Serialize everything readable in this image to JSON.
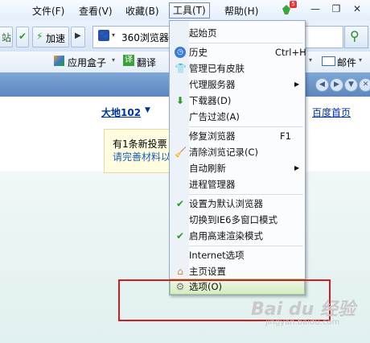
{
  "menubar": {
    "items": [
      "文件(F)",
      "查看(V)",
      "收藏(B)",
      "工具(T)",
      "帮助(H)"
    ],
    "badge": "5"
  },
  "toolbar": {
    "left_text": "站",
    "speed_label": "加速",
    "address_text": "360浏览器"
  },
  "favbar": {
    "items": [
      "应用盒子",
      "翻译",
      "邮件"
    ]
  },
  "content": {
    "user_link": "大地102",
    "homepage_link": "百度首页",
    "popup_line1": "有1条新投票",
    "popup_line2": "请完善材料以"
  },
  "tools_menu": {
    "items": [
      {
        "label": "起始页",
        "shortcut": "",
        "icon": "",
        "submenu": false
      },
      {
        "label": "历史",
        "shortcut": "Ctrl+H",
        "icon": "clock-icon",
        "submenu": false
      },
      {
        "label": "管理已有皮肤",
        "shortcut": "",
        "icon": "shirt-icon",
        "submenu": false
      },
      {
        "label": "代理服务器",
        "shortcut": "",
        "icon": "",
        "submenu": true
      },
      {
        "label": "下载器(D)",
        "shortcut": "",
        "icon": "download-icon",
        "submenu": false
      },
      {
        "label": "广告过滤(A)",
        "shortcut": "",
        "icon": "",
        "submenu": false
      },
      {
        "label": "修复浏览器",
        "shortcut": "F1",
        "icon": "",
        "submenu": false
      },
      {
        "label": "清除浏览记录(C)",
        "shortcut": "",
        "icon": "broom-icon",
        "submenu": false
      },
      {
        "label": "自动刷新",
        "shortcut": "",
        "icon": "",
        "submenu": true
      },
      {
        "label": "进程管理器",
        "shortcut": "",
        "icon": "",
        "submenu": false
      },
      {
        "label": "设置为默认浏览器",
        "shortcut": "",
        "icon": "check-icon",
        "submenu": false
      },
      {
        "label": "切换到IE6多窗口模式",
        "shortcut": "",
        "icon": "",
        "submenu": false
      },
      {
        "label": "启用高速渲染模式",
        "shortcut": "",
        "icon": "check-icon",
        "submenu": false
      },
      {
        "label": "Internet选项",
        "shortcut": "",
        "icon": "",
        "submenu": false
      },
      {
        "label": "主页设置",
        "shortcut": "",
        "icon": "home-icon",
        "submenu": false
      },
      {
        "label": "选项(O)",
        "shortcut": "",
        "icon": "gear-icon",
        "submenu": false,
        "highlighted": true
      }
    ]
  },
  "watermark": {
    "text": "Bai du 经验",
    "url": "jingyan.baidu.com"
  }
}
